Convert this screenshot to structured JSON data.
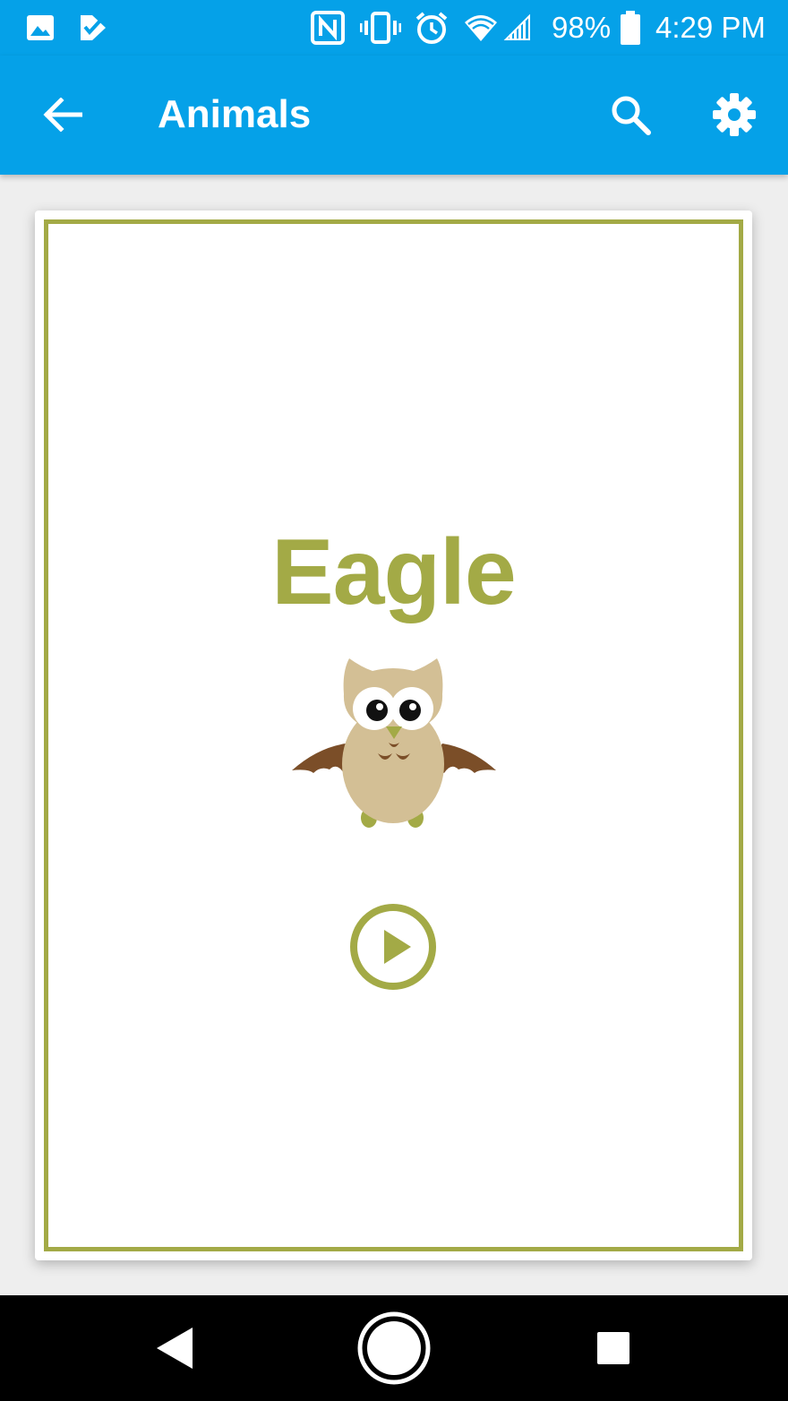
{
  "status_bar": {
    "battery_percent": "98%",
    "time": "4:29 PM",
    "icons": [
      "image-icon",
      "checkmark-app-icon",
      "nfc-icon",
      "vibrate-icon",
      "alarm-icon",
      "wifi-icon",
      "signal-icon",
      "battery-icon"
    ]
  },
  "app_bar": {
    "title": "Animals",
    "back_icon": "back-arrow-icon",
    "search_icon": "search-icon",
    "settings_icon": "gear-icon"
  },
  "card": {
    "word": "Eagle",
    "illustration": "owl-icon",
    "play_icon": "play-icon"
  },
  "nav_bar": {
    "icons": [
      "nav-back-icon",
      "nav-home-icon",
      "nav-recents-icon"
    ]
  },
  "colors": {
    "primary": "#05a1e8",
    "accent": "#a3aa46",
    "owl_body": "#d3bf95",
    "owl_wing": "#7b4e28",
    "nav_bar": "#000000"
  }
}
